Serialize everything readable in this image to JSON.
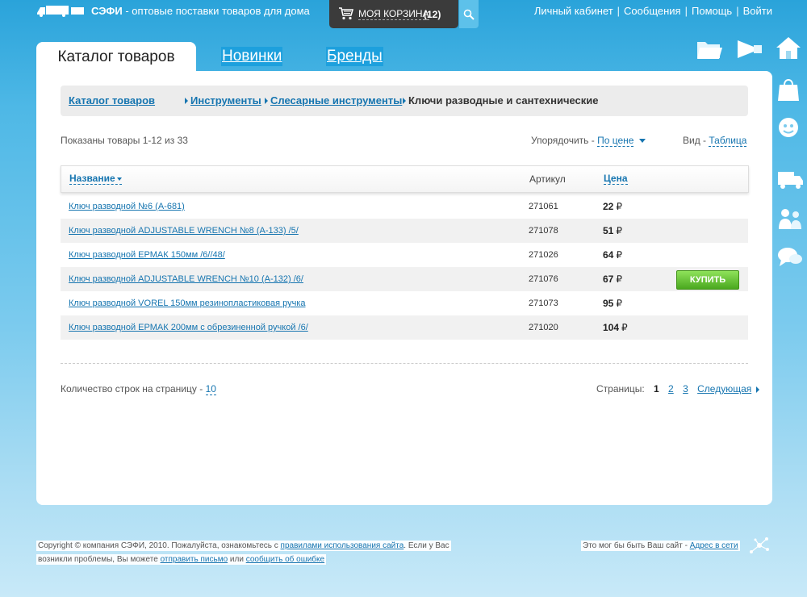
{
  "header": {
    "brand_name": "СЭФИ",
    "brand_tagline": "- оптовые поставки товаров для дома",
    "cart_label": "МОЯ КОРЗИНА",
    "cart_count": "(12)",
    "user_menu": [
      "Личный кабинет",
      "Сообщения",
      "Помощь",
      "Войти"
    ]
  },
  "tabs": [
    {
      "label": "Каталог товаров",
      "active": true
    },
    {
      "label": "Новинки",
      "active": false
    },
    {
      "label": "Бренды",
      "active": false
    }
  ],
  "right_icons": [
    "folder-icon",
    "megaphone-icon",
    "home-icon",
    "shopping-bag-icon",
    "support-headset-icon",
    "delivery-truck-icon",
    "people-icon",
    "chat-bubbles-icon"
  ],
  "breadcrumbs": {
    "items": [
      "Каталог товаров",
      "Инструменты",
      "Слесарные инструменты"
    ],
    "current": "Ключи разводные и сантехнические"
  },
  "listing": {
    "shown_text": "Показаны товары 1-12 из 33",
    "sort_label": "Упорядочить -",
    "sort_value": "По цене",
    "view_label": "Вид -",
    "view_value": "Таблица"
  },
  "table": {
    "col_name": "Название",
    "col_article": "Артикул",
    "col_price": "Цена",
    "currency": "₽",
    "buy_label": "КУПИТЬ",
    "rows": [
      {
        "name": "Ключ разводной №6 (А-681)",
        "article": "271061",
        "price": "22"
      },
      {
        "name": "Ключ разводной ADJUSTABLE WRENCH №8 (А-133) /5/",
        "article": "271078",
        "price": "51"
      },
      {
        "name": "Ключ разводной ЕРМАК 150мм /6//48/",
        "article": "271026",
        "price": "64"
      },
      {
        "name": "Ключ разводной ADJUSTABLE WRENCH №10 (А-132) /6/",
        "article": "271076",
        "price": "67"
      },
      {
        "name": "Ключ разводной VOREL 150мм резинопластиковая ручка",
        "article": "271073",
        "price": "95"
      },
      {
        "name": "Ключ разводной ЕРМАК 200мм с обрезиненной ручкой /6/",
        "article": "271020",
        "price": "104"
      }
    ]
  },
  "pagination": {
    "per_page_label": "Количество строк на страницу -",
    "per_page_value": "10",
    "pages_label": "Страницы:",
    "current": "1",
    "pages": [
      "2",
      "3"
    ],
    "next_label": "Следующая"
  },
  "footer": {
    "copyright": "Copyright © компания СЭФИ, 2010. Пожалуйста, ознакомьтесь с",
    "rules_link": "правилами использования сайта",
    "after_rules": ". Если у Вас",
    "problems": "возникли проблемы, Вы можете",
    "send_link": "отправить письмо",
    "or": "или",
    "report_link": "сообщить об ошибке",
    "right_text": "Это мог бы быть Ваш сайт -",
    "right_link": "Адрес в сети"
  },
  "colors": {
    "link": "#1675b0",
    "buy_button": "#4aa81f",
    "background_sky": "#4eb8e6"
  }
}
